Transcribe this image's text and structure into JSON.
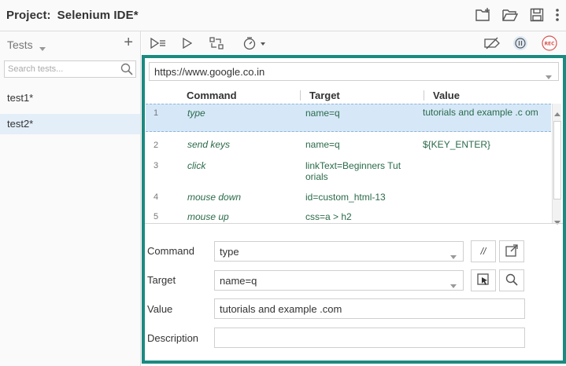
{
  "header": {
    "project_label": "Project:",
    "project_name": "Selenium IDE*",
    "icons": [
      "new-folder-icon",
      "open-folder-icon",
      "save-icon",
      "more-vertical-icon"
    ]
  },
  "sidebar": {
    "title": "Tests",
    "add_label": "+",
    "search_placeholder": "Search tests...",
    "tests": [
      {
        "name": "test1*",
        "selected": false
      },
      {
        "name": "test2*",
        "selected": true
      }
    ]
  },
  "toolbar": {
    "icons": [
      "run-all-tests-icon",
      "run-current-test-icon",
      "step-over-icon",
      "speed-timer-icon",
      "disable-breakpoints-icon",
      "pause-on-exceptions-icon",
      "record-icon"
    ],
    "record_label": "REC"
  },
  "editor": {
    "base_url": "https://www.google.co.in",
    "columns": [
      "Command",
      "Target",
      "Value"
    ],
    "rows": [
      {
        "num": "1",
        "command": "type",
        "target": "name=q",
        "value": "tutorials and example .c om",
        "selected": true
      },
      {
        "num": "2",
        "command": "send keys",
        "target": "name=q",
        "value": "${KEY_ENTER}",
        "selected": false
      },
      {
        "num": "3",
        "command": "click",
        "target": "linkText=Beginners Tut orials",
        "value": "",
        "selected": false
      },
      {
        "num": "4",
        "command": "mouse down",
        "target": "id=custom_html-13",
        "value": "",
        "selected": false
      },
      {
        "num": "5",
        "command": "mouse up",
        "target": "css=a > h2",
        "value": "",
        "selected": false
      }
    ]
  },
  "command_editor": {
    "command_label": "Command",
    "command_value": "type",
    "comment_button_label": "//",
    "target_label": "Target",
    "target_value": "name=q",
    "value_label": "Value",
    "value_value": "tutorials and example .com",
    "description_label": "Description",
    "description_value": ""
  },
  "colors": {
    "frame_border": "#1b8a80",
    "selected_row": "#d6e8f8",
    "selected_test": "#e3eef9",
    "command_text": "#2a6a4a",
    "record_icon": "#d9534f"
  }
}
